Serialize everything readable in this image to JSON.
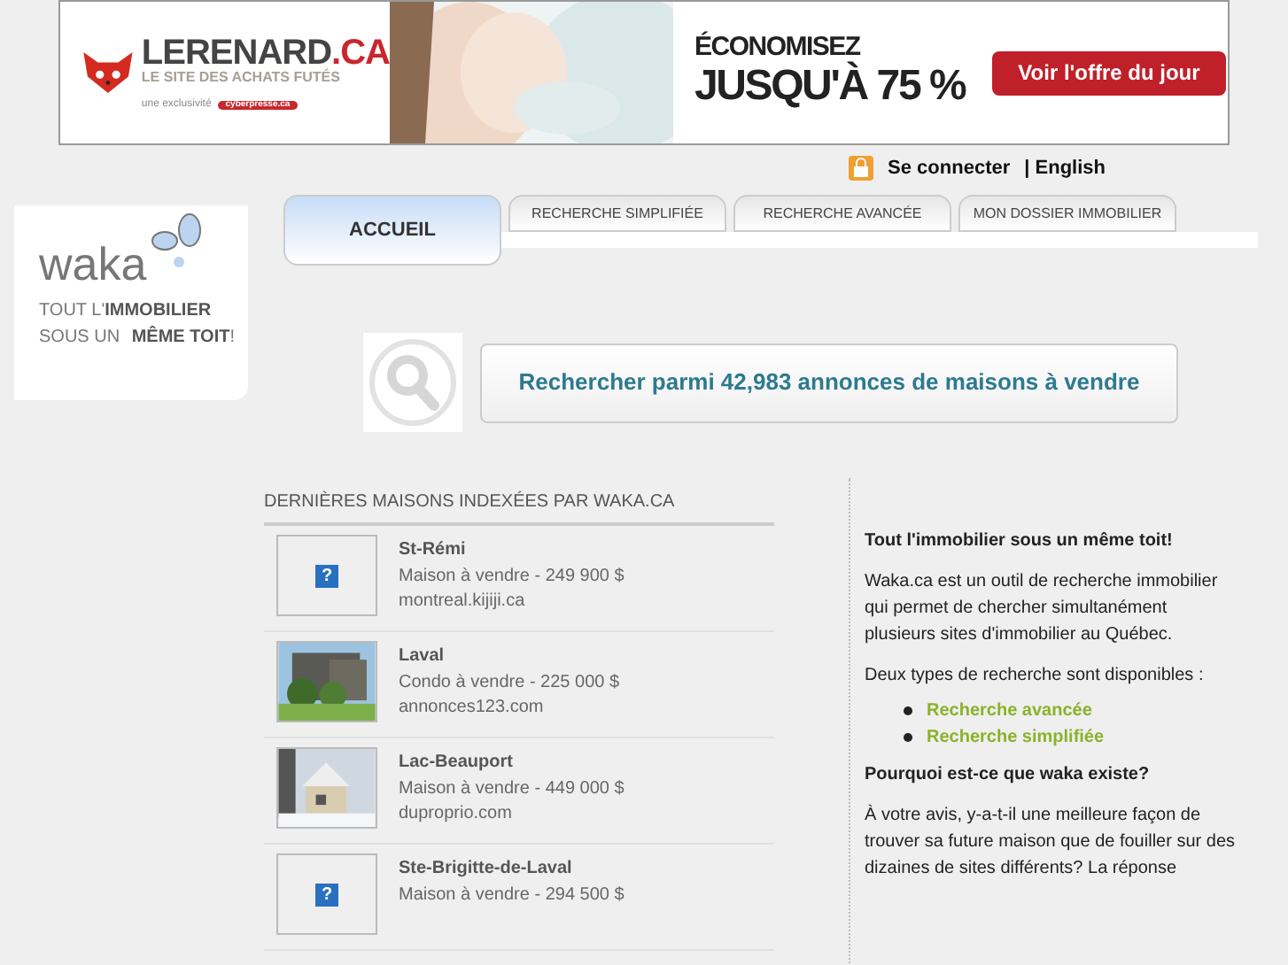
{
  "banner": {
    "brand": "LERENARD",
    "brand_suffix": ".CA",
    "tagline": "LE SITE DES ACHATS FUTÉS",
    "exclusive": "une exclusivité",
    "partner": "cyberpresse.ca",
    "headline_small": "ÉCONOMISEZ",
    "headline_big": "JUSQU'À 75 %",
    "cta": "Voir l'offre du jour"
  },
  "top_links": {
    "login": "Se connecter",
    "language": "| English"
  },
  "logo": {
    "wordmark": "waka",
    "line1_plain": "TOUT L'",
    "line1_bold": "IMMOBILIER",
    "line2_plain": "SOUS UN ",
    "line2_bold": "MÊME TOIT",
    "line2_end": "!"
  },
  "tabs": [
    {
      "label": "ACCUEIL",
      "selected": true
    },
    {
      "label": "RECHERCHE SIMPLIFIÉE",
      "selected": false
    },
    {
      "label": "RECHERCHE AVANCÉE",
      "selected": false
    },
    {
      "label": "MON DOSSIER IMMOBILIER",
      "selected": false
    }
  ],
  "search_button": "Rechercher parmi 42,983 annonces de maisons à vendre",
  "listings": {
    "title": "DERNIÈRES MAISONS INDEXÉES PAR WAKA.CA",
    "items": [
      {
        "kind": "placeholder",
        "icon_text": "?",
        "city": "St-Rémi",
        "desc": "Maison à vendre - 249 900 $",
        "source": "montreal.kijiji.ca"
      },
      {
        "city": "Laval",
        "desc": "Condo à vendre - 225 000 $",
        "source": "annonces123.com"
      },
      {
        "city": "Lac-Beauport",
        "desc": "Maison à vendre - 449 000 $",
        "source": "duproprio.com"
      },
      {
        "kind": "placeholder",
        "icon_text": "?",
        "city": "Ste-Brigitte-de-Laval",
        "desc": "Maison à vendre - 294 500 $"
      }
    ]
  },
  "about": {
    "heading": "Tout l'immobilier sous un même toit!",
    "para1": "Waka.ca est un outil de recherche immobilier qui permet de chercher simultanément plusieurs sites d'immobilier au Québec.",
    "para2": "Deux types de recherche sont disponibles :",
    "links": [
      "Recherche avancée",
      "Recherche simplifiée"
    ],
    "heading2": "Pourquoi est-ce que waka existe?",
    "para3": "À votre avis, y-a-t-il une meilleure façon de trouver sa future maison que de fouiller sur des dizaines de sites différents? La réponse"
  }
}
